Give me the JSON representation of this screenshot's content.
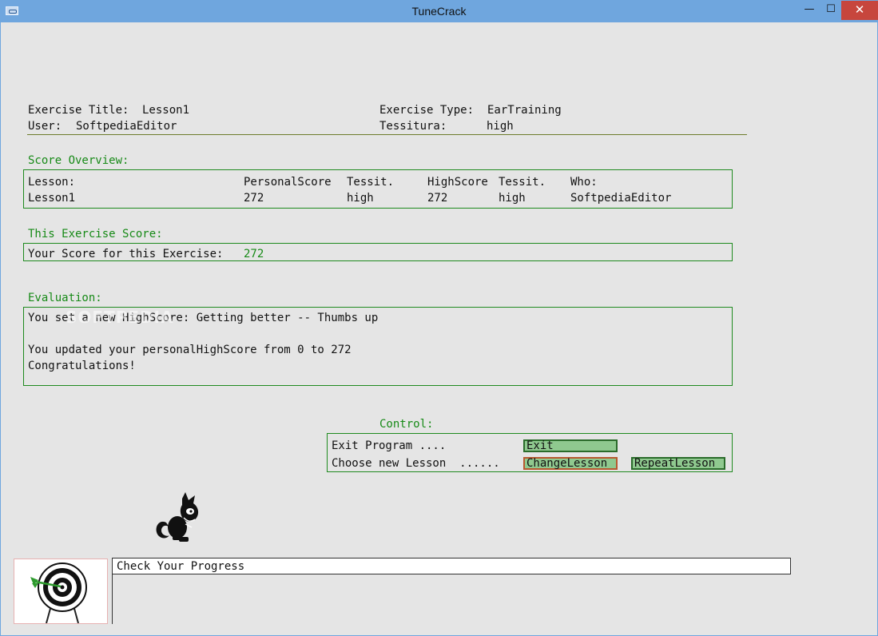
{
  "window": {
    "title": "TuneCrack",
    "minimize_glyph": "—",
    "maximize_glyph": "☐",
    "close_glyph": "✕"
  },
  "header": {
    "exercise_title_label": "Exercise Title:",
    "exercise_title_value": "Lesson1",
    "user_label": "User:",
    "user_value": "SoftpediaEditor",
    "exercise_type_label": "Exercise Type:",
    "exercise_type_value": "EarTraining",
    "tessitura_label": "Tessitura:",
    "tessitura_value": "high"
  },
  "score_overview": {
    "heading": "Score Overview:",
    "columns": [
      "Lesson:",
      "PersonalScore",
      "Tessit.",
      "HighScore",
      "Tessit.",
      "Who:"
    ],
    "rows": [
      [
        "Lesson1",
        "272",
        "high",
        "272",
        "high",
        "SoftpediaEditor"
      ]
    ]
  },
  "exercise_score": {
    "heading": "This Exercise Score:",
    "label": "Your Score for this Exercise:",
    "value": "272"
  },
  "evaluation": {
    "heading": "Evaluation:",
    "line1": "You set a new HighScore: Getting better -- Thumbs up",
    "line2": "You updated your personalHighScore from 0 to 272",
    "line3": "Congratulations!",
    "watermark": "SOFTPEDIA"
  },
  "control": {
    "heading": "Control:",
    "exit_label": "Exit Program ....",
    "exit_button": "Exit",
    "lesson_label": "Choose new Lesson  ......",
    "change_button": "ChangeLesson",
    "repeat_button": "RepeatLesson"
  },
  "progress": {
    "label": "Check Your Progress"
  },
  "icons": {
    "mascot": "cat-mascot-icon",
    "target": "target-icon"
  },
  "colors": {
    "titlebar": "#6fa6de",
    "accent_green": "#178a17",
    "button_fill": "#8fc98f",
    "close": "#c7463d"
  }
}
